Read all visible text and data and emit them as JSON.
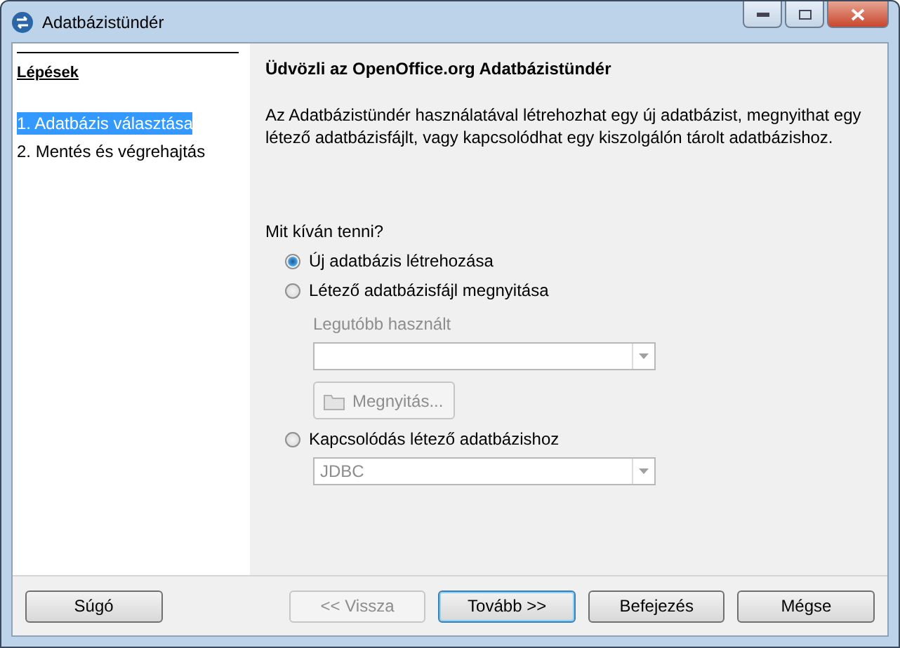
{
  "window": {
    "title": "Adatbázistündér"
  },
  "sidebar": {
    "heading": "Lépések",
    "items": [
      {
        "label": "1. Adatbázis választása",
        "selected": true
      },
      {
        "label": "2. Mentés és végrehajtás",
        "selected": false
      }
    ]
  },
  "content": {
    "heading": "Üdvözli az OpenOffice.org Adatbázistündér",
    "description": "Az Adatbázistündér használatával létrehozhat egy új adatbázist, megnyithat egy létező adatbázisfájlt, vagy kapcsolódhat egy kiszolgálón tárolt adatbázishoz.",
    "question": "Mit kíván tenni?",
    "options": [
      {
        "kind": "plain",
        "label": "Új adatbázis létrehozása",
        "selected": true
      },
      {
        "kind": "open",
        "label": "Létező adatbázisfájl megnyitása",
        "selected": false,
        "recent_label": "Legutóbb használt",
        "open_button": "Megnyitás...",
        "disabled": true
      },
      {
        "kind": "connect",
        "label": "Kapcsolódás létező adatbázishoz",
        "selected": false,
        "dropdown_value": "JDBC",
        "disabled": true
      }
    ]
  },
  "buttons": [
    {
      "label": "Súgó",
      "disabled": false,
      "default": false
    },
    {
      "label": "<< Vissza",
      "disabled": true,
      "default": false
    },
    {
      "label": "Tovább >>",
      "disabled": false,
      "default": true
    },
    {
      "label": "Befejezés",
      "disabled": false,
      "default": false
    },
    {
      "label": "Mégse",
      "disabled": false,
      "default": false
    }
  ]
}
